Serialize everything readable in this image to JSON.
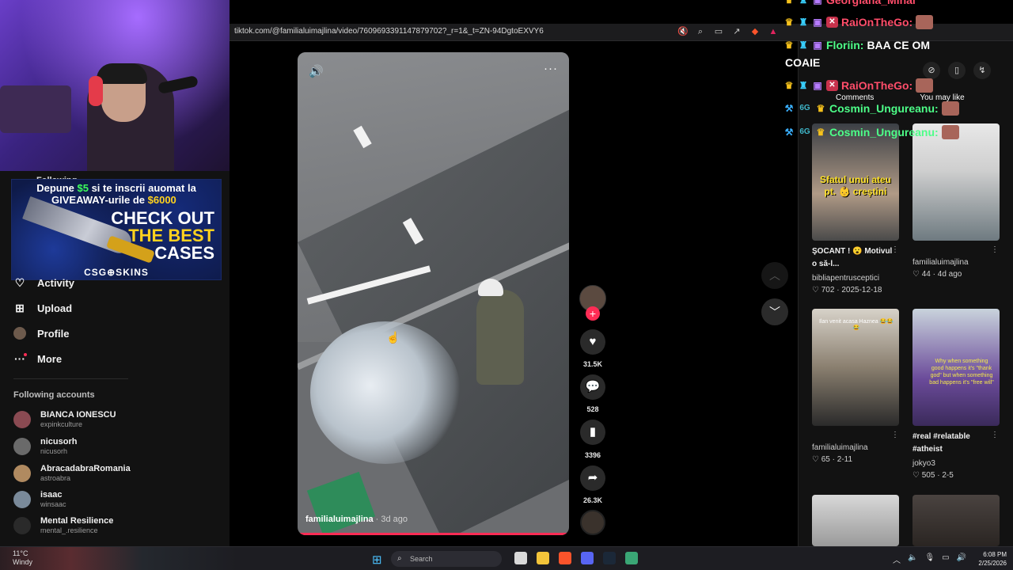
{
  "browser": {
    "url": "tiktok.com/@familialuimajlina/video/7609693391147879702?_r=1&_t=ZN-94DgtoEXVY6"
  },
  "ad": {
    "line1_pre": "Depune ",
    "line1_amount": "$5",
    "line1_post": " si te inscrii auomat la",
    "line2_pre": "GIVEAWAY-urile de ",
    "line2_amount": "$6000",
    "big1": "CHECK OUT",
    "big2": "THE BEST",
    "big3": "CASES",
    "brand": "CSG⊕SKINS"
  },
  "sidebar": {
    "following_peek": "Following",
    "nav": [
      {
        "label": "Activity",
        "icon": "activity-icon"
      },
      {
        "label": "Upload",
        "icon": "plus-square-icon"
      },
      {
        "label": "Profile",
        "icon": "avatar"
      },
      {
        "label": "More",
        "icon": "more-dots-icon"
      }
    ],
    "following_title": "Following accounts",
    "accounts": [
      {
        "name": "BIANCA IONESCU",
        "handle": "expinkculture",
        "color": "#8a4a52"
      },
      {
        "name": "nicusorh",
        "handle": "nicusorh",
        "color": "#6a6a6a"
      },
      {
        "name": "AbracadabraRomania",
        "handle": "astroabra",
        "color": "#b08a60"
      },
      {
        "name": "isaac",
        "handle": "winsaac",
        "color": "#7a8a9a"
      },
      {
        "name": "Mental Resilience",
        "handle": "mental_.resilience",
        "color": "#2a2a2a"
      }
    ]
  },
  "video": {
    "author": "familialuimajlina",
    "ago": " · 3d ago",
    "progress": 1.0
  },
  "actions": {
    "likes": "31.5K",
    "comments": "528",
    "saves": "3396",
    "shares": "26.3K"
  },
  "right_panel": {
    "tab_comments": "Comments",
    "tab_may_like": "You may like",
    "items": [
      {
        "caption": "ŞOCANT ! 😮 Motivul o să-l...",
        "author": "bibliapentrusceptici",
        "likes": "702",
        "date": "2025-12-18",
        "overlay": "Sfatul unui ateu pt. 👶 creştini"
      },
      {
        "caption": "",
        "author": "familialuimajlina",
        "likes": "44",
        "date": "4d ago",
        "overlay": ""
      },
      {
        "caption": "",
        "author": "familialuimajlina",
        "likes": "65",
        "date": "2-11",
        "overlay": "Ilan venit acasa Haznea 😂😂😂"
      },
      {
        "caption": "#real #relatable #atheist",
        "author": "jokyo3",
        "likes": "505",
        "date": "2-5",
        "overlay": "Why when something good happens it's \"thank god\" but when something bad happens it's \"free will\""
      }
    ]
  },
  "chat": [
    {
      "name": "Georgiana_Mihai",
      "msg": "",
      "color": "pink"
    },
    {
      "name": "RaiOnTheGo:",
      "msg": "",
      "color": "pink"
    },
    {
      "name": "Floriin:",
      "msg": "BAA CE OM",
      "color": "green"
    },
    {
      "name": "",
      "msg": "COAIE",
      "color": "green"
    },
    {
      "name": "RaiOnTheGo:",
      "msg": "",
      "color": "pink"
    },
    {
      "name": "Cosmin_Ungureanu:",
      "msg": "",
      "color": "green"
    },
    {
      "name": "Cosmin_Ungureanu:",
      "msg": "",
      "color": "green"
    }
  ],
  "taskbar": {
    "temp": "11°C",
    "weather": "Windy",
    "search_placeholder": "Search",
    "time": "6:08 PM",
    "date": "2/25/2026"
  }
}
